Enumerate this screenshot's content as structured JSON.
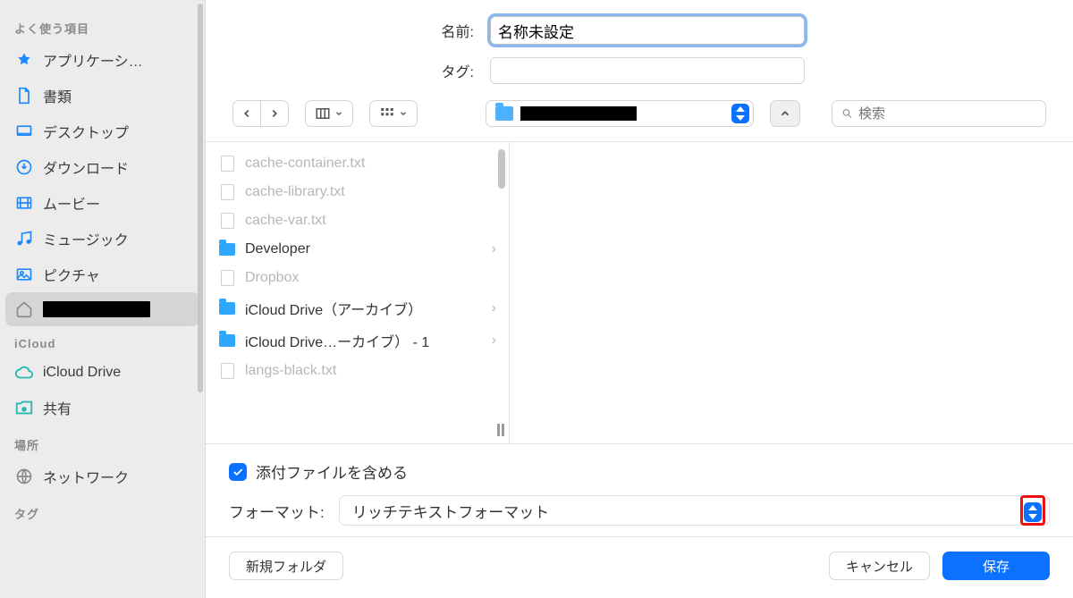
{
  "sidebar": {
    "sections": {
      "favorites_label": "よく使う項目",
      "icloud_label": "iCloud",
      "locations_label": "場所",
      "tags_label": "タグ"
    },
    "items": {
      "applications": "アプリケーシ…",
      "documents": "書類",
      "desktop": "デスクトップ",
      "downloads": "ダウンロード",
      "movies": "ムービー",
      "music": "ミュージック",
      "pictures": "ピクチャ",
      "home": "",
      "icloud_drive": "iCloud Drive",
      "shared": "共有",
      "network": "ネットワーク"
    }
  },
  "header": {
    "name_label": "名前:",
    "name_value": "名称未設定",
    "tags_label": "タグ:",
    "tags_value": ""
  },
  "toolbar": {
    "path_name": "",
    "search_placeholder": "検索"
  },
  "files": [
    {
      "name": "cache-container.txt",
      "type": "file",
      "dim": true
    },
    {
      "name": "cache-library.txt",
      "type": "file",
      "dim": true
    },
    {
      "name": "cache-var.txt",
      "type": "file",
      "dim": true
    },
    {
      "name": "Developer",
      "type": "folder",
      "dim": false,
      "has_children": true
    },
    {
      "name": "Dropbox",
      "type": "file",
      "dim": true
    },
    {
      "name": "iCloud Drive（アーカイブ）",
      "type": "folder",
      "dim": false,
      "has_children": true
    },
    {
      "name": "iCloud Drive…ーカイブ） - 1",
      "type": "folder",
      "dim": false,
      "has_children": true
    },
    {
      "name": "langs-black.txt",
      "type": "file",
      "dim": true
    }
  ],
  "options": {
    "include_attachments_label": "添付ファイルを含める",
    "include_attachments_checked": true,
    "format_label": "フォーマット:",
    "format_value": "リッチテキストフォーマット"
  },
  "footer": {
    "new_folder": "新規フォルダ",
    "cancel": "キャンセル",
    "save": "保存"
  }
}
